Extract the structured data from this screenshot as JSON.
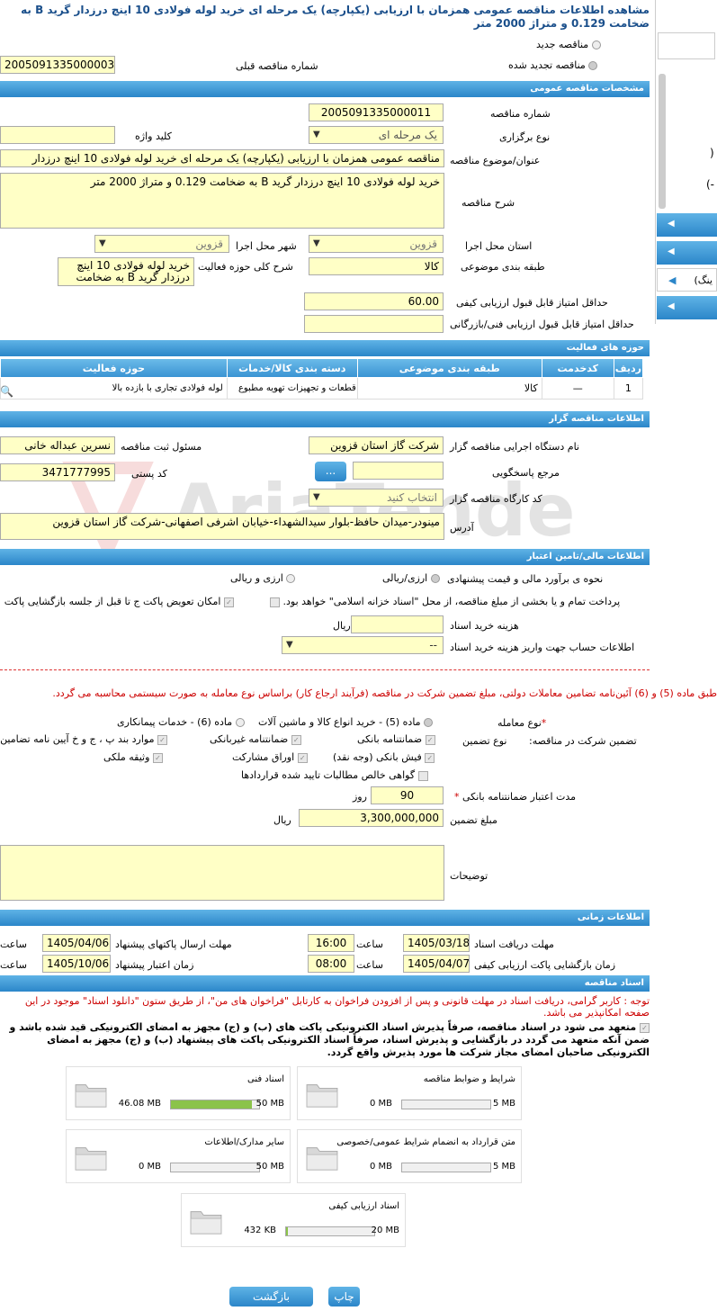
{
  "title": "مشاهده اطلاعات مناقصه عمومی همزمان با ارزیابی (یکپارچه) یک مرحله ای خرید لوله فولادی 10 اینچ درزدار گرید B به ضخامت 0.129 و متراژ 2000 متر",
  "options": {
    "new": "مناقصه جدید",
    "renewed": "مناقصه تجدید شده",
    "prev_label": "شماره مناقصه قبلی",
    "prev_value": "2005091335000003"
  },
  "general": {
    "header": "مشخصات مناقصه عمومی",
    "number_label": "شماره مناقصه",
    "number": "2005091335000011",
    "type_label": "نوع برگزاری",
    "type": "یک مرحله ای",
    "keyword_label": "کلید واژه",
    "subject_label": "عنوان/موضوع مناقصه",
    "subject": "مناقصه عمومی همزمان با ارزیابی (یکپارچه) یک مرحله ای خرید لوله فولادی 10 اینچ درزدار",
    "desc_label": "شرح مناقصه",
    "desc": "خرید لوله فولادی 10 اینچ درزدار گرید B به ضخامت 0.129 و متراژ 2000 متر",
    "province_label": "استان محل اجرا",
    "province": "قزوین",
    "city_label": "شهر محل اجرا",
    "city": "قزوین",
    "category_label": "طبقه بندی موضوعی",
    "category": "کالا",
    "scope_label": "شرح کلی حوزه فعالیت",
    "scope": "خرید لوله فولادی 10 اینچ درزدار گرید B به ضخامت",
    "minq_label": "حداقل امتیاز قابل قبول ارزیابی کیفی",
    "minq": "60.00",
    "mint_label": "حداقل امتیاز قابل قبول ارزیابی فنی/بازرگانی"
  },
  "activity": {
    "header": "حوزه های فعالیت",
    "cols": [
      "ردیف",
      "کدخدمت",
      "طبقه بندی موضوعی",
      "دسته بندی کالا/خدمات",
      "حوزه فعالیت"
    ],
    "rows": [
      [
        "1",
        "—",
        "کالا",
        "قطعات و تجهیزات تهویه مطبوع",
        "لوله فولادی تجاری با بازده بالا"
      ]
    ]
  },
  "org": {
    "header": "اطلاعات مناقصه گزار",
    "name_label": "نام دستگاه اجرایی مناقصه گزار",
    "name": "شرکت گاز استان قزوین",
    "resp_label": "مسئول ثبت مناقصه",
    "resp": "نسرین عبداله خانی",
    "ref_label": "مرجع پاسخگویی",
    "ref_btn": "...",
    "postal_label": "کد پستی",
    "postal": "3471777995",
    "workshop_label": "کد کارگاه مناقصه گزار",
    "workshop": "انتخاب کنید",
    "address_label": "آدرس",
    "address": "مینودر-میدان حافظ-بلوار سیدالشهداء-خیابان اشرفی اصفهانی-شرکت گاز استان قزوین"
  },
  "finance": {
    "header": "اطلاعات مالی/تامین اعتبار",
    "estimate_label": "نحوه ی برآورد مالی و قیمت پیشنهادی",
    "opt1": "ارزی/ریالی",
    "opt2": "ارزی و ریالی",
    "treasury": "پرداخت تمام و یا بخشی از مبلغ مناقصه، از محل \"اسناد خزانه اسلامی\" خواهد بود.",
    "swap": "امکان تعویض پاکت ج تا قبل از جلسه بازگشایی پاکت",
    "doc_cost_label": "هزینه خرید اسناد",
    "rial": "ریال",
    "account_label": "اطلاعات حساب جهت واریز هزینه خرید اسناد",
    "account": "--"
  },
  "guarantee": {
    "notice": "طبق ماده (5) و (6) آئین‌نامه تضامین معاملات دولتی، مبلغ تضمین شرکت در مناقصه (فرآیند ارجاع کار) براساس نوع معامله به صورت سیستمی محاسبه می گردد.",
    "deal_label": "نوع معامله",
    "deal1": "ماده (5) - خرید انواع کالا و ماشین آلات",
    "deal2": "ماده (6) - خدمات پیمانکاری",
    "part_label": "تضمین شرکت در مناقصه:",
    "type_label": "نوع تضمین",
    "g1": "ضمانتنامه بانکی",
    "g2": "ضمانتنامه غیربانکی",
    "g3": "موارد بند پ ، ج و خ آیین نامه تضامین",
    "g4": "فیش بانکی (وجه نقد)",
    "g5": "اوراق مشارکت",
    "g6": "وثیقه ملکی",
    "g7": "گواهی خالص مطالبات تایید شده قراردادها",
    "validity_label": "مدت اعتبار ضمانتنامه بانکی",
    "validity": "90",
    "day": "روز",
    "amount_label": "مبلغ تضمین",
    "amount": "3,300,000,000",
    "rial": "ریال",
    "desc_label": "توضیحات"
  },
  "timing": {
    "header": "اطلاعات زمانی",
    "receive_label": "مهلت دریافت اسناد",
    "receive_date": "1405/03/18",
    "receive_time": "16:00",
    "send_label": "مهلت ارسال پاکتهای پیشنهاد",
    "send_date": "1405/04/06",
    "open_label": "زمان بازگشایی پاکت ارزیابی کیفی",
    "open_date": "1405/04/07",
    "open_time": "08:00",
    "valid_label": "زمان اعتبار پیشنهاد",
    "valid_date": "1405/10/06",
    "hour": "ساعت"
  },
  "docs": {
    "header": "اسناد مناقصه",
    "note": "توجه : کاربر گرامی، دریافت اسناد در مهلت قانونی و پس از افزودن فراخوان به کارتابل \"فراخوان های من\"، از طریق ستون \"دانلود اسناد\" موجود در این صفحه امکانپذیر می باشد.",
    "commit": "متعهد می شود در اسناد مناقصه، صرفاً پذیرش اسناد الکترونیکی پاکت های (ب) و (ج) مجهز به امضای الکترونیکی قید شده باشد و ضمن آنکه متعهد می گردد در بازگشایی و پذیرش اسناد، صرفاً اسناد الکترونیکی پاکت های پیشنهاد (ب) و (ج) مجهز به امضای الکترونیکی صاحبان امضای مجاز شرکت ها مورد پذیرش واقع گردد.",
    "cards": [
      {
        "name": "شرایط و ضوابط مناقصه",
        "used": "0 MB",
        "max": "5 MB",
        "pct": 0
      },
      {
        "name": "اسناد فنی",
        "used": "46.08 MB",
        "max": "50 MB",
        "pct": 0.92
      },
      {
        "name": "متن قرارداد به انضمام شرایط عمومی/خصوصی",
        "used": "0 MB",
        "max": "5 MB",
        "pct": 0
      },
      {
        "name": "سایر مدارک/اطلاعات",
        "used": "0 MB",
        "max": "50 MB",
        "pct": 0
      },
      {
        "name": "اسناد ارزیابی کیفی",
        "used": "432 KB",
        "max": "20 MB",
        "pct": 0.02
      }
    ]
  },
  "buttons": {
    "print": "چاپ",
    "back": "بازگشت"
  },
  "side": {
    "t1": ")",
    "t2": "(-",
    "t3": "ینگ)"
  }
}
